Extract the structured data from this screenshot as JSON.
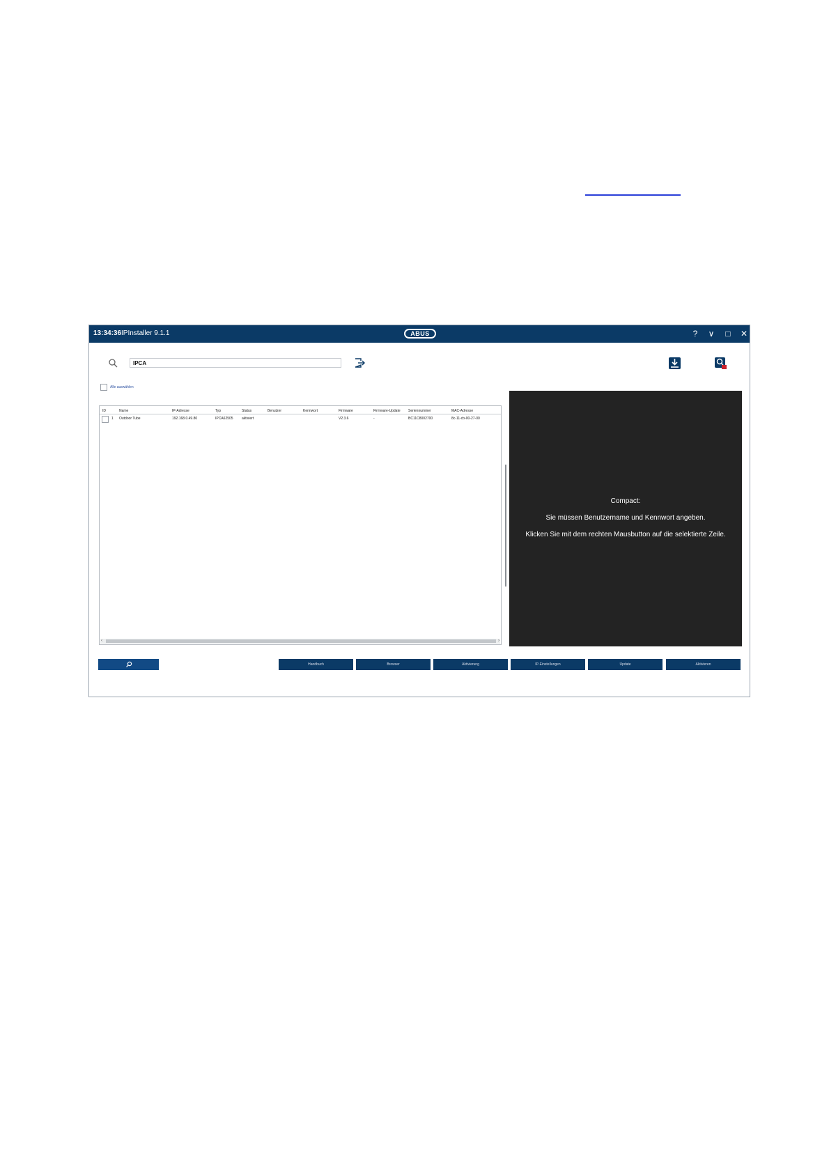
{
  "titlebar": {
    "clock": "13:34:36",
    "app_title": "IPInstaller 9.1.1",
    "logo": "ABUS",
    "help": "?",
    "minimize": "∨",
    "maximize": "□",
    "close": "✕"
  },
  "toolbar": {
    "search_value": "IPCA",
    "search_icon": "search-icon",
    "export_icon": "export-icon",
    "firmware_icon": "firmware-download-icon",
    "scan_icon": "network-scan-icon"
  },
  "select_all_label": "Alle auswählen",
  "table": {
    "columns": [
      "ID",
      "Name",
      "IP-Adresse",
      "Typ",
      "Status",
      "Benutzer",
      "Kennwort",
      "Firmware",
      "Firmware-Update",
      "Seriennummer",
      "MAC-Adresse"
    ],
    "rows": [
      {
        "id": "1",
        "name": "Outdoor Tube",
        "ip": "192.168.0.49.80",
        "type": "IPCA62505",
        "status": "aktiviert",
        "user": "",
        "password": "",
        "firmware": "V2.3.6",
        "firmware_update": "-",
        "serial": "BC11C8002700",
        "mac": "8c-11-cb-00-27-00"
      }
    ]
  },
  "info_panel": {
    "line1": "Compact:",
    "line2": "Sie müssen Benutzername und Kennwort angeben.",
    "line3": "Klicken Sie mit dem rechten Mausbutton auf die selektierte Zeile."
  },
  "buttons": {
    "handbook": "Handbuch",
    "browser": "Browser",
    "activation": "Aktivierung",
    "ip_settings": "IP-Einstellungen",
    "update": "Update",
    "settings": "Aktivieren"
  },
  "colors": {
    "titlebar": "#0b3a66",
    "panel": "#232323",
    "link": "#2a3fd8"
  }
}
